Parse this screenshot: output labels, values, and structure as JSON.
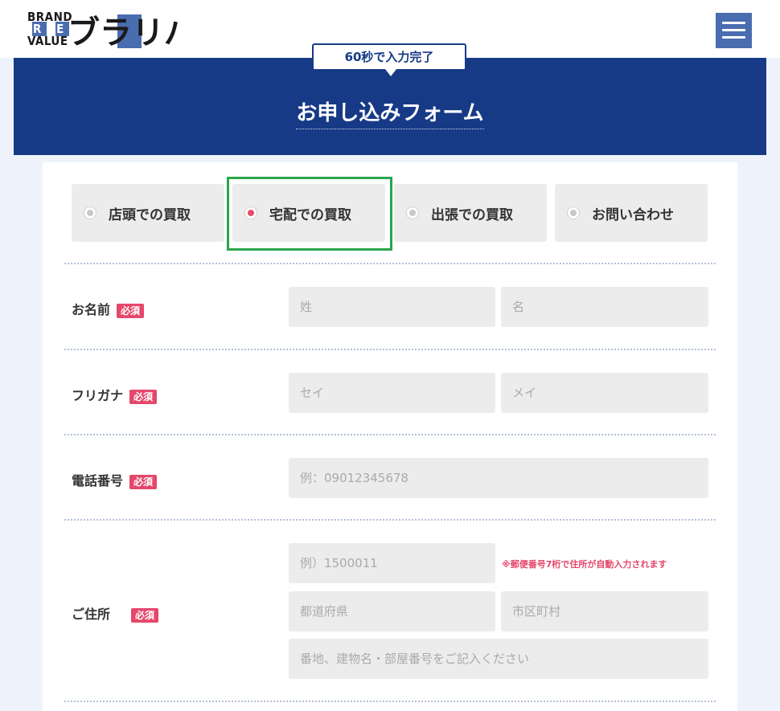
{
  "header": {
    "logo_lines": [
      "BRAND",
      "R E",
      "VALUE"
    ],
    "logo_mark": "ブラリバ",
    "menu_icon": "hamburger-menu-icon",
    "accent_color": "#4a6db0"
  },
  "banner": {
    "bubble": "60秒で入力完了",
    "title": "お申し込みフォーム",
    "color": "#173a86"
  },
  "tabs": [
    {
      "label": "店頭での買取",
      "selected": false
    },
    {
      "label": "宅配での買取",
      "selected": true
    },
    {
      "label": "出張での買取",
      "selected": false
    },
    {
      "label": "お問い合わせ",
      "selected": false
    }
  ],
  "form": {
    "required_badge": "必須",
    "name": {
      "label": "お名前",
      "last_placeholder": "姓",
      "first_placeholder": "名"
    },
    "kana": {
      "label": "フリガナ",
      "last_placeholder": "セイ",
      "first_placeholder": "メイ"
    },
    "phone": {
      "label": "電話番号",
      "placeholder": "例：09012345678"
    },
    "address": {
      "label": "ご住所",
      "postal_placeholder": "例）1500011",
      "postal_note": "※郵便番号7桁で住所が自動入力されます",
      "prefecture_placeholder": "都道府県",
      "city_placeholder": "市区町村",
      "street_placeholder": "番地、建物名・部屋番号をご記入ください"
    }
  },
  "colors": {
    "required": "#e4476a",
    "radio_selected": "#e44d6b",
    "highlight": "#2aa54c"
  }
}
